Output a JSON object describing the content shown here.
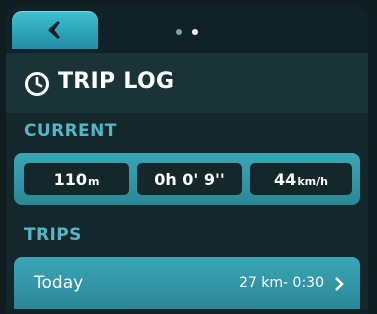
{
  "header": {
    "title": "TRIP LOG"
  },
  "current": {
    "label": "CURRENT",
    "distance": {
      "value": "110",
      "unit": "m"
    },
    "duration": "0h 0' 9''",
    "speed": {
      "value": "44",
      "unit": "km/h"
    }
  },
  "trips": {
    "label": "TRIPS",
    "items": [
      {
        "name": "Today",
        "summary": "27 km- 0:30"
      }
    ]
  },
  "colors": {
    "accent": "#3aa6b6",
    "label": "#53b6c7",
    "background": "#14272b"
  },
  "icons": [
    "back-arrow-icon",
    "clock-icon",
    "chevron-right-icon"
  ]
}
